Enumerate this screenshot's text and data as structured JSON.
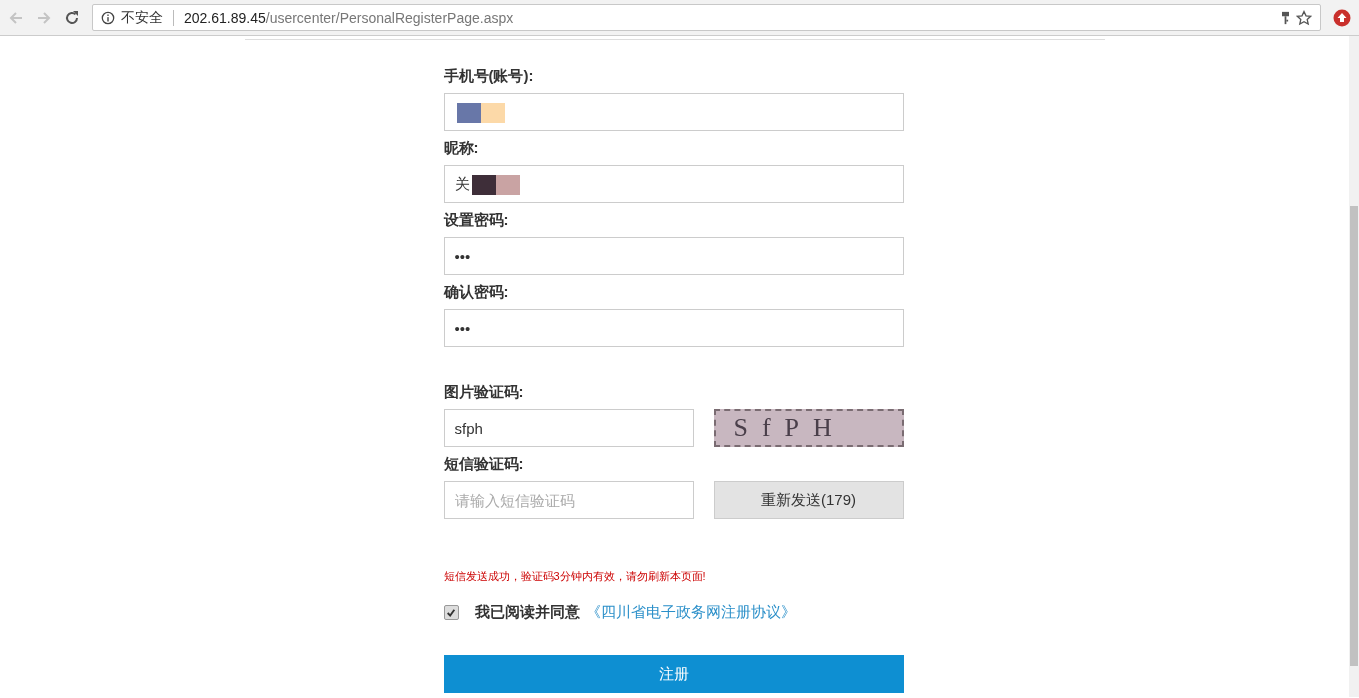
{
  "browser": {
    "security_label": "不安全",
    "url_host": "202.61.89.45",
    "url_path": "/usercenter/PersonalRegisterPage.aspx"
  },
  "fields": [
    {
      "label": "手机号(账号):",
      "kind": "redacted"
    },
    {
      "label": "昵称:",
      "value": "关",
      "kind": "redacted"
    },
    {
      "label": "设置密码:",
      "value": "•••",
      "kind": "text"
    },
    {
      "label": "确认密码:",
      "value": "•••",
      "kind": "text"
    }
  ],
  "captcha": {
    "label": "图片验证码:",
    "value": "sfph",
    "image_text": "SfPH"
  },
  "sms": {
    "label": "短信验证码:",
    "placeholder": "请输入短信验证码",
    "button": "重新发送(179)"
  },
  "message": "短信发送成功，验证码3分钟内有效，请勿刷新本页面!",
  "agreement": {
    "checked": true,
    "text": "我已阅读并同意",
    "link": "《四川省电子政务网注册协议》"
  },
  "submit": "注册"
}
